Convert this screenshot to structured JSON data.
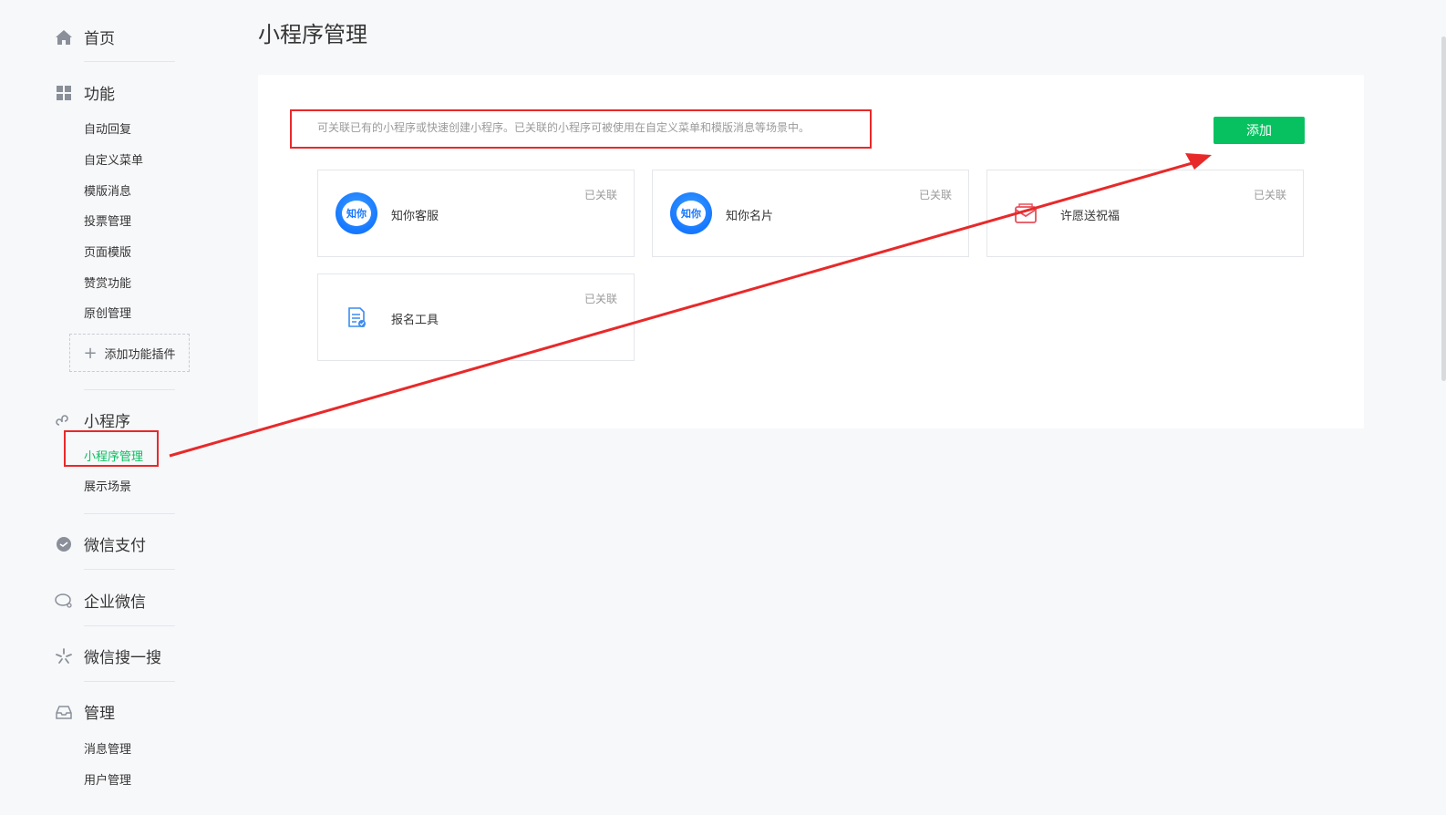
{
  "sidebar": {
    "home": "首页",
    "features": {
      "title": "功能",
      "items": [
        "自动回复",
        "自定义菜单",
        "模版消息",
        "投票管理",
        "页面模版",
        "赞赏功能",
        "原创管理"
      ],
      "add_plugin": "添加功能插件"
    },
    "miniprogram": {
      "title": "小程序",
      "items": [
        "小程序管理",
        "展示场景"
      ]
    },
    "wechat_pay": "微信支付",
    "wecom": "企业微信",
    "search": "微信搜一搜",
    "manage": {
      "title": "管理",
      "items": [
        "消息管理",
        "用户管理"
      ]
    }
  },
  "main": {
    "title": "小程序管理",
    "tip": "可关联已有的小程序或快速创建小程序。已关联的小程序可被使用在自定义菜单和模版消息等场景中。",
    "add_button": "添加",
    "cards": [
      {
        "name": "知你客服",
        "status": "已关联",
        "icon": "zhini-logo",
        "logo_text": "知你"
      },
      {
        "name": "知你名片",
        "status": "已关联",
        "icon": "zhini-logo",
        "logo_text": "知你"
      },
      {
        "name": "许愿送祝福",
        "status": "已关联",
        "icon": "envelope-icon"
      },
      {
        "name": "报名工具",
        "status": "已关联",
        "icon": "form-doc-icon"
      }
    ]
  },
  "colors": {
    "accent": "#07c160",
    "annotation": "#e8292a"
  }
}
